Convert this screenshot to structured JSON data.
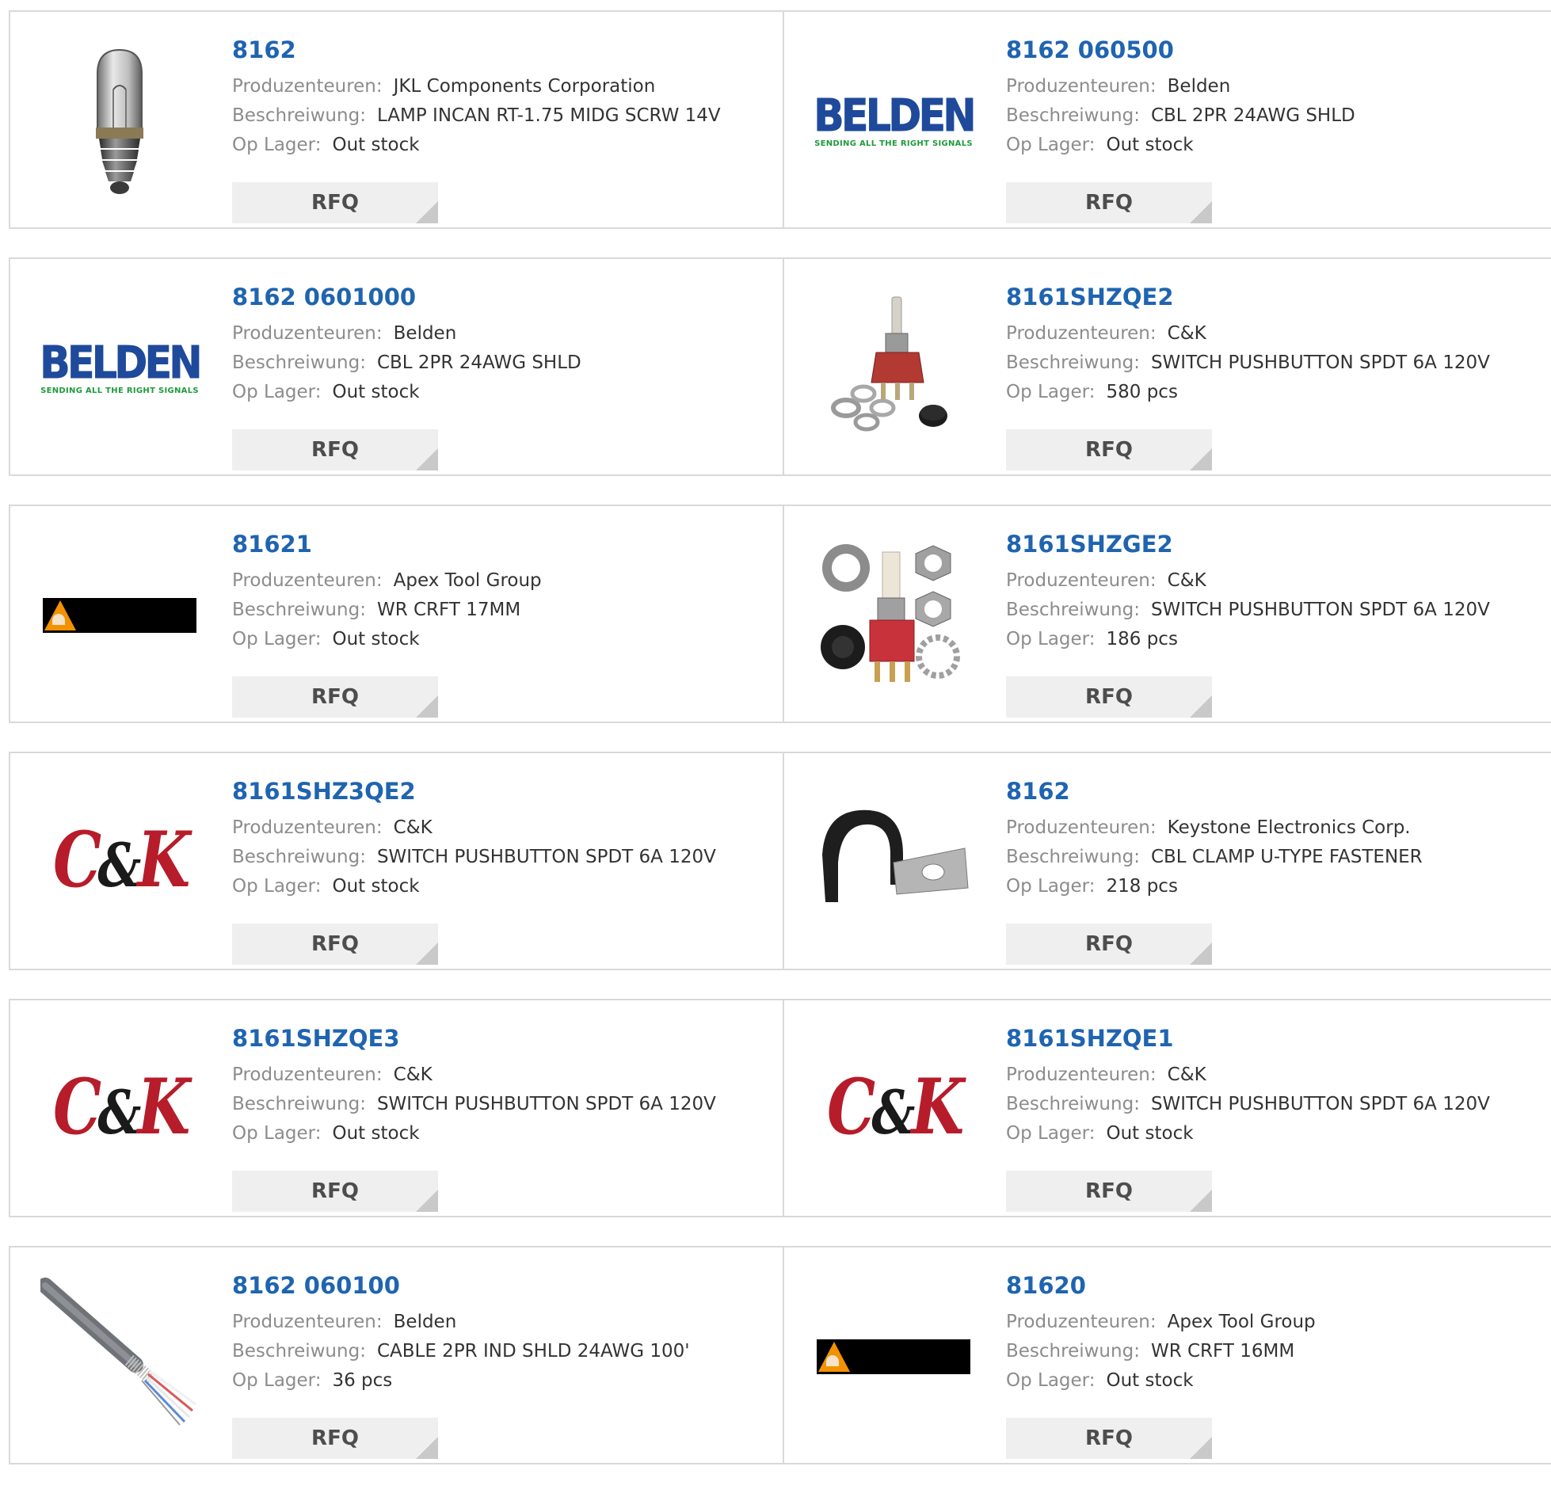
{
  "labels": {
    "manufacturer": "Produzenteuren:",
    "description": "Beschreiwung:",
    "stock": "Op Lager:",
    "rfq": "RFQ"
  },
  "colors": {
    "link": "#1f64b0",
    "label": "#8c8c8c",
    "value": "#333333",
    "border": "#d9d9d9",
    "rfq_bg": "#efefef"
  },
  "brand_logos": {
    "belden_word": "BELDEN",
    "belden_tagline": "SENDING ALL THE RIGHT SIGNALS",
    "ck_c": "C",
    "ck_amp": "&",
    "ck_k": "K"
  },
  "products": [
    {
      "part": "8162",
      "manufacturer": "JKL Components Corporation",
      "description": "LAMP INCAN RT-1.75 MIDG SCRW 14V",
      "stock": "Out stock",
      "image": "lamp-bulb-image"
    },
    {
      "part": "8162 060500",
      "manufacturer": "Belden",
      "description": "CBL 2PR 24AWG SHLD",
      "stock": "Out stock",
      "image": "belden-logo"
    },
    {
      "part": "8162 0601000",
      "manufacturer": "Belden",
      "description": "CBL 2PR 24AWG SHLD",
      "stock": "Out stock",
      "image": "belden-logo"
    },
    {
      "part": "8161SHZQE2",
      "manufacturer": "C&K",
      "description": "SWITCH PUSHBUTTON SPDT 6A 120V",
      "stock": "580 pcs",
      "image": "pushbutton-switch-image"
    },
    {
      "part": "81621",
      "manufacturer": "Apex Tool Group",
      "description": "WR CRFT 17MM",
      "stock": "Out stock",
      "image": "apex-logo"
    },
    {
      "part": "8161SHZGE2",
      "manufacturer": "C&K",
      "description": "SWITCH PUSHBUTTON SPDT 6A 120V",
      "stock": "186 pcs",
      "image": "pushbutton-switch-image"
    },
    {
      "part": "8161SHZ3QE2",
      "manufacturer": "C&K",
      "description": "SWITCH PUSHBUTTON SPDT 6A 120V",
      "stock": "Out stock",
      "image": "ck-logo"
    },
    {
      "part": "8162",
      "manufacturer": "Keystone Electronics Corp.",
      "description": "CBL CLAMP U-TYPE FASTENER",
      "stock": "218 pcs",
      "image": "cable-clamp-image"
    },
    {
      "part": "8161SHZQE3",
      "manufacturer": "C&K",
      "description": "SWITCH PUSHBUTTON SPDT 6A 120V",
      "stock": "Out stock",
      "image": "ck-logo"
    },
    {
      "part": "8161SHZQE1",
      "manufacturer": "C&K",
      "description": "SWITCH PUSHBUTTON SPDT 6A 120V",
      "stock": "Out stock",
      "image": "ck-logo"
    },
    {
      "part": "8162 060100",
      "manufacturer": "Belden",
      "description": "CABLE 2PR IND SHLD 24AWG 100'",
      "stock": "36 pcs",
      "image": "shielded-cable-image"
    },
    {
      "part": "81620",
      "manufacturer": "Apex Tool Group",
      "description": "WR CRFT 16MM",
      "stock": "Out stock",
      "image": "apex-logo"
    }
  ]
}
